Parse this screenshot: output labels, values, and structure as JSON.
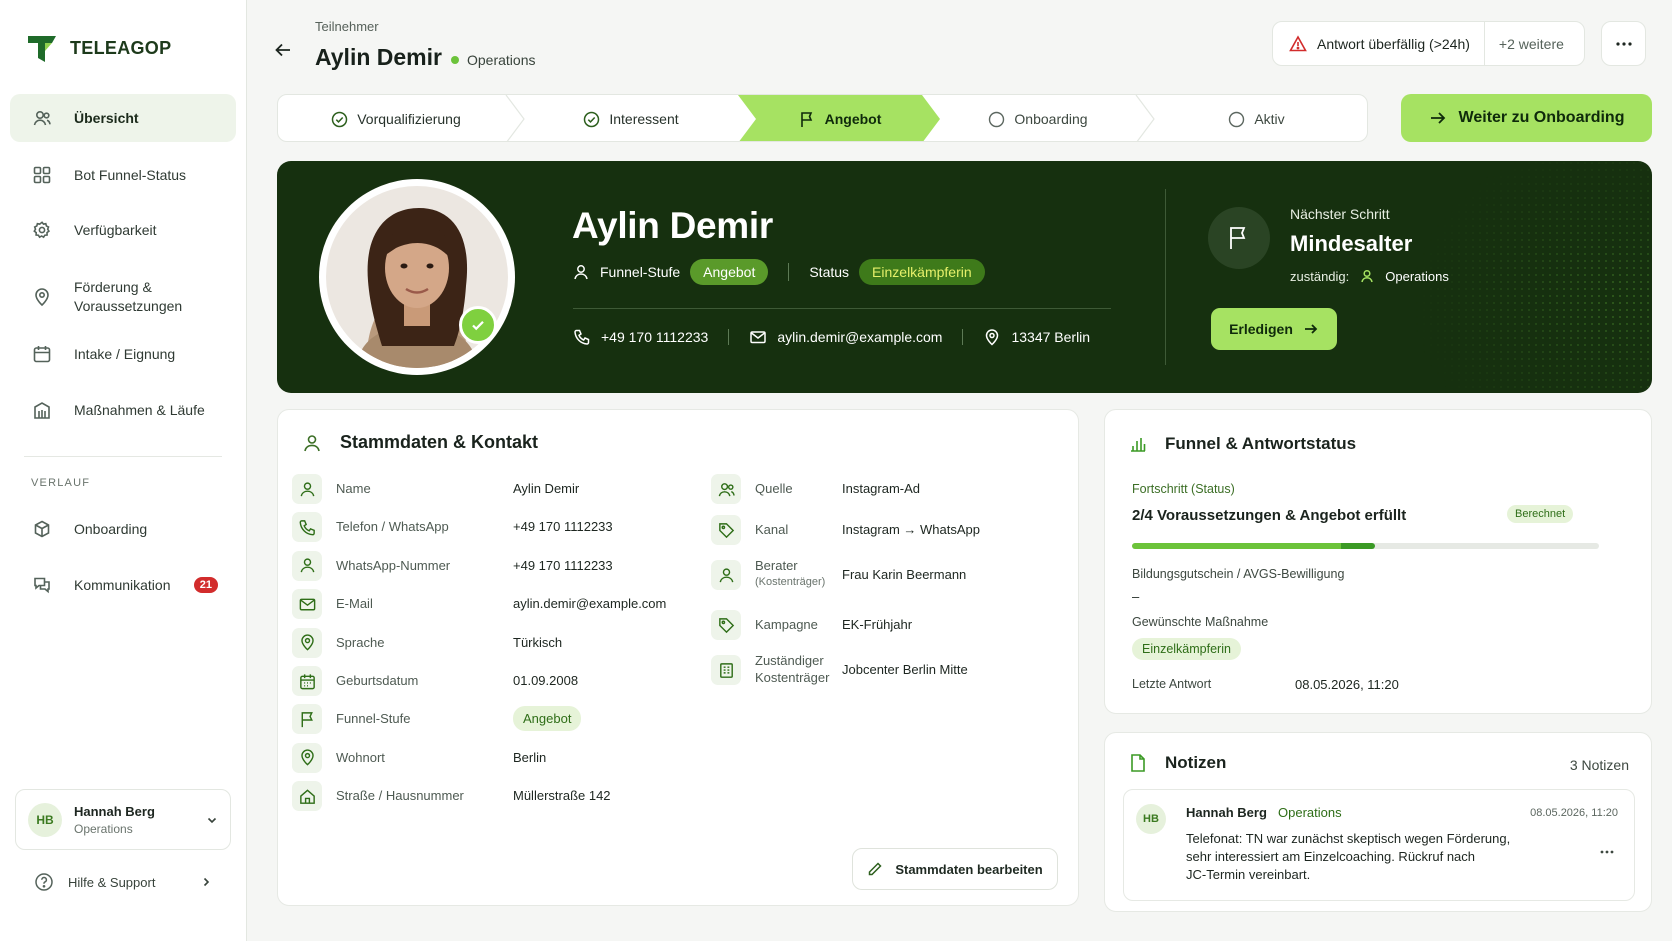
{
  "brand": {
    "name": "TELEAGOP",
    "colors": {
      "accent": "#a6e262",
      "hero_bg": "#16300f",
      "danger": "#d22c2c"
    }
  },
  "sidebar": {
    "items": [
      {
        "label": "Übersicht",
        "icon": "users-icon"
      },
      {
        "label": "Bot Funnel-Status",
        "icon": "grid-icon"
      },
      {
        "label": "Verfügbarkeit",
        "icon": "gear-icon"
      },
      {
        "label": "Förderung & Voraussetzungen",
        "icon": "location-pin-icon"
      },
      {
        "label": "Intake / Eignung",
        "icon": "calendar-icon"
      },
      {
        "label": "Maßnahmen & Läufe",
        "icon": "building-icon"
      }
    ],
    "section_label": "VERLAUF",
    "history": [
      {
        "label": "Onboarding",
        "icon": "cube-icon"
      },
      {
        "label": "Kommunikation",
        "icon": "chat-icon",
        "badge": "21"
      }
    ],
    "user": {
      "initials": "HB",
      "name": "Hannah Berg",
      "role": "Operations"
    },
    "help": "Hilfe & Support"
  },
  "header": {
    "breadcrumb": "Teilnehmer",
    "title": "Aylin Demir",
    "department": "Operations",
    "alert": "Antwort überfällig (>24h)",
    "alert_more": "+2 weitere"
  },
  "steps": [
    {
      "label": "Vorqualifizierung",
      "state": "done"
    },
    {
      "label": "Interessent",
      "state": "done"
    },
    {
      "label": "Angebot",
      "state": "active"
    },
    {
      "label": "Onboarding",
      "state": "open"
    },
    {
      "label": "Aktiv",
      "state": "open"
    }
  ],
  "cta_label": "Weiter zu Onboarding",
  "hero": {
    "name": "Aylin Demir",
    "funnel_label": "Funnel-Stufe",
    "funnel_value": "Angebot",
    "status_label": "Status",
    "status_value": "Einzelkämpferin",
    "phone": "+49 170 1112233",
    "email": "aylin.demir@example.com",
    "location": "13347 Berlin",
    "next_label": "Nächster Schritt",
    "next_value": "Mindesalter",
    "owner_label": "zuständig:",
    "owner_value": "Operations",
    "done_button": "Erledigen"
  },
  "stammdaten": {
    "title": "Stammdaten & Kontakt",
    "left": [
      {
        "label": "Name",
        "value": "Aylin Demir",
        "icon": "person-icon"
      },
      {
        "label": "Telefon / WhatsApp",
        "value": "+49 170 1112233",
        "icon": "phone-icon"
      },
      {
        "label": "WhatsApp-Nummer",
        "value": "+49 170 1112233",
        "icon": "person-icon"
      },
      {
        "label": "E-Mail",
        "value": "aylin.demir@example.com",
        "icon": "mail-icon"
      },
      {
        "label": "Sprache",
        "value": "Türkisch",
        "icon": "location-pin-icon"
      },
      {
        "label": "Geburtsdatum",
        "value": "01.09.2008",
        "icon": "calendar-icon"
      },
      {
        "label": "Funnel-Stufe",
        "value": "Angebot",
        "icon": "flag-icon"
      },
      {
        "label": "Wohnort",
        "value": "Berlin",
        "icon": "location-pin-icon"
      },
      {
        "label": "Straße / Hausnummer",
        "value": "Müllerstraße 142",
        "icon": "home-icon"
      }
    ],
    "right": [
      {
        "label": "Quelle",
        "sublabel": "",
        "value": "Instagram-Ad",
        "icon": "users-icon"
      },
      {
        "label": "Kanal",
        "sublabel": "",
        "value": "Instagram → WhatsApp",
        "icon": "tag-icon"
      },
      {
        "label": "Berater",
        "sublabel": "(Kostenträger)",
        "value": "Frau Karin Beermann",
        "icon": "person-icon"
      },
      {
        "label": "Kampagne",
        "sublabel": "",
        "value": "EK-Frühjahr",
        "icon": "tag-icon"
      },
      {
        "label": "Zuständiger",
        "sublabel": "Kostenträger",
        "value": "Jobcenter Berlin Mitte",
        "icon": "building-icon"
      }
    ],
    "edit_button": "Stammdaten bearbeiten"
  },
  "funnel": {
    "title": "Funnel & Antwortstatus",
    "progress_label": "Fortschritt (Status)",
    "progress_text": "2/4 Voraussetzungen & Angebot erfüllt",
    "progress_fraction": 0.52,
    "calc_badge": "Berechnet",
    "voucher_label": "Bildungsgutschein / AVGS-Bewilligung",
    "voucher_value": "–",
    "measure_label": "Gewünschte Maßnahme",
    "measure_value": "Einzelkämpferin",
    "last_label": "Letzte Antwort",
    "last_value": "08.05.2026, 11:20"
  },
  "notes": {
    "title": "Notizen",
    "count": "3 Notizen",
    "items": [
      {
        "initials": "HB",
        "author": "Hannah Berg",
        "team": "Operations",
        "date": "08.05.2026, 11:20",
        "lines": [
          "Telefonat: TN war zunächst skeptisch wegen Förderung,",
          "sehr interessiert am Einzelcoaching. Rückruf nach",
          "JC-Termin vereinbart."
        ]
      }
    ]
  }
}
